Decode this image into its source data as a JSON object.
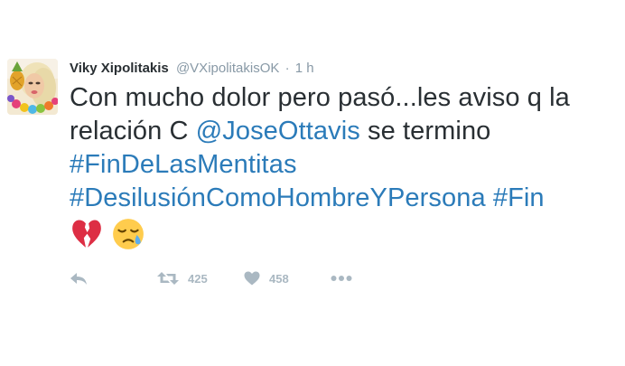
{
  "tweet": {
    "author": {
      "fullname": "Viky Xipolitakis",
      "username": "@VXipolitakisOK",
      "separator": "·",
      "time": "1 h"
    },
    "text": {
      "line1": "Con mucho dolor pero pasó...les aviso q la",
      "line2_prefix": "relación C ",
      "mention": "@JoseOttavis",
      "line2_suffix": " se termino",
      "hashtag1": "#FinDeLasMentitas",
      "hashtag2": "#DesilusiónComoHombreYPersona",
      "hashtag3_space": " ",
      "hashtag3": "#Fin"
    },
    "emojis": [
      "broken-heart-emoji",
      "sad-relieved-face-emoji"
    ],
    "actions": {
      "reply_icon": "reply-icon",
      "retweet_icon": "retweet-icon",
      "retweet_count": "425",
      "like_icon": "heart-icon",
      "like_count": "458",
      "more_icon": "more-icon"
    },
    "colors": {
      "link": "#2b7bb9",
      "text": "#292f33",
      "meta": "#8899a6",
      "action": "#aab8c2"
    }
  }
}
